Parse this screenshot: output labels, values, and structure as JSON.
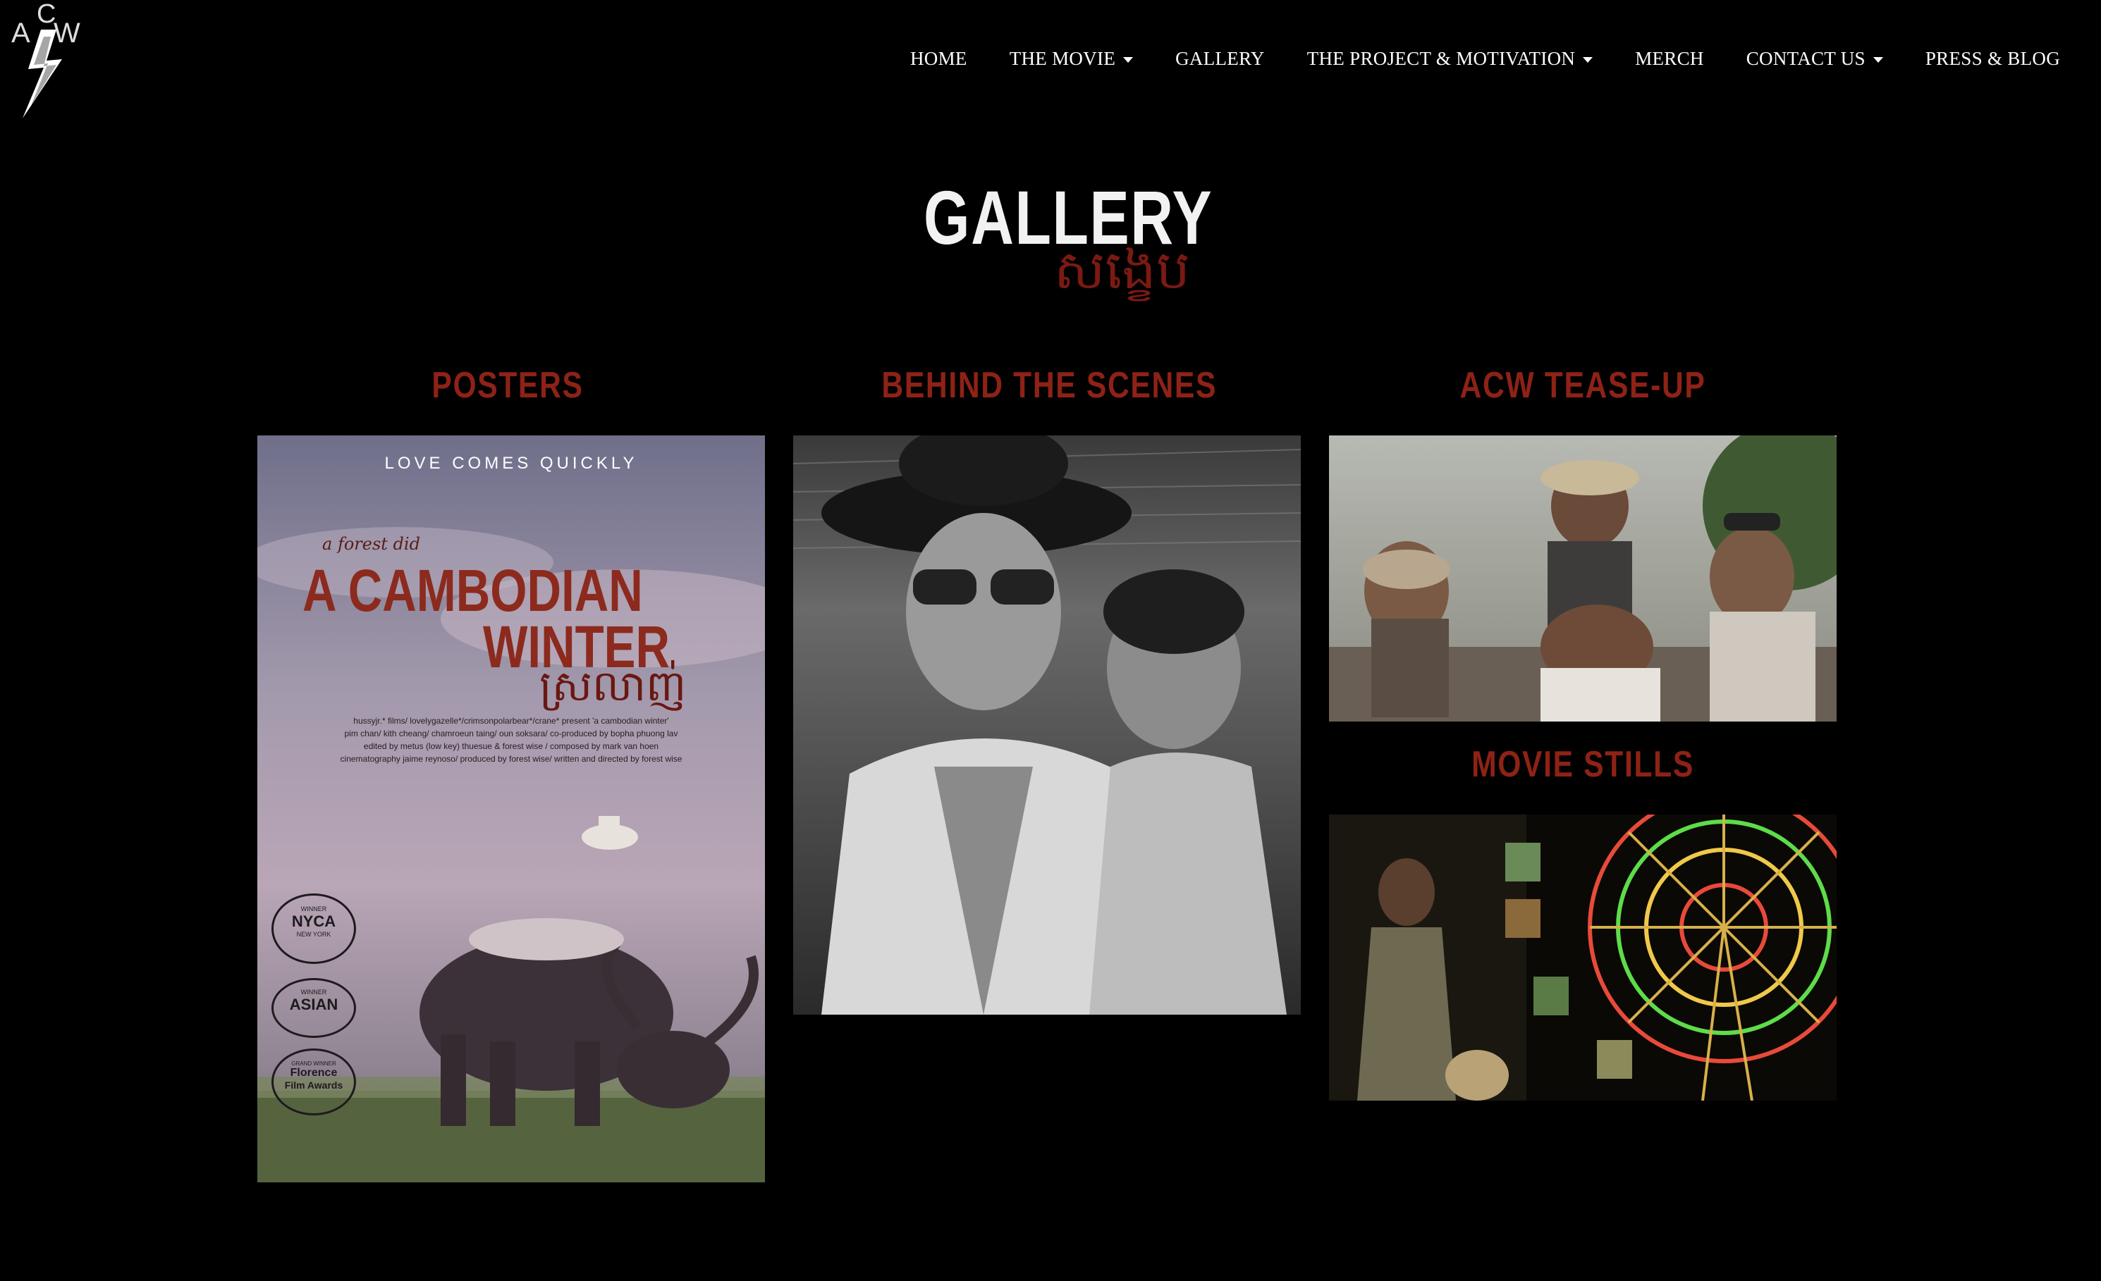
{
  "site": {
    "logo_text": "ACW"
  },
  "nav": {
    "items": [
      {
        "label": "HOME",
        "dropdown": false
      },
      {
        "label": "THE MOVIE",
        "dropdown": true
      },
      {
        "label": "GALLERY",
        "dropdown": false
      },
      {
        "label": "THE PROJECT & MOTIVATION",
        "dropdown": true
      },
      {
        "label": "MERCH",
        "dropdown": false
      },
      {
        "label": "CONTACT US",
        "dropdown": true
      },
      {
        "label": "PRESS & BLOG",
        "dropdown": false
      }
    ]
  },
  "page": {
    "title": "GALLERY",
    "title_khmer": "សង្ខេប"
  },
  "sections": {
    "posters": {
      "heading": "POSTERS",
      "poster": {
        "tagline": "LOVE COMES QUICKLY",
        "byline": "a forest did",
        "title_line1": "A CAMBODIAN",
        "title_line2": "WINTER",
        "title_khmer": "ស្រលាញ់",
        "credits_1": "hussyjr.* films/ lovelygazelle*/crimsonpolarbear*/crane* present 'a cambodian winter'",
        "credits_2": "pim chan/ kith cheang/ chamroeun taing/ oun soksara/ co-produced by bopha phuong lav",
        "credits_3": "edited by metus (low key) thuesue &  forest wise / composed by mark van hoen",
        "credits_4": "cinematography jaime reynoso/ produced by forest wise/ written and directed by forest wise",
        "laurel_1_top": "WINNER",
        "laurel_1": "NYCA",
        "laurel_1_sub": "NEW YORK",
        "laurel_2_top": "WINNER",
        "laurel_2": "ASIAN",
        "laurel_3_top": "GRAND WINNER",
        "laurel_3a": "Florence",
        "laurel_3b": "Film Awards"
      }
    },
    "behind": {
      "heading": "BEHIND THE SCENES"
    },
    "teaseup": {
      "heading": "ACW TEASE-UP"
    },
    "stills": {
      "heading": "MOVIE STILLS"
    }
  },
  "colors": {
    "background": "#000000",
    "heading_red": "#8e2216",
    "nav_text": "#ffffff"
  }
}
